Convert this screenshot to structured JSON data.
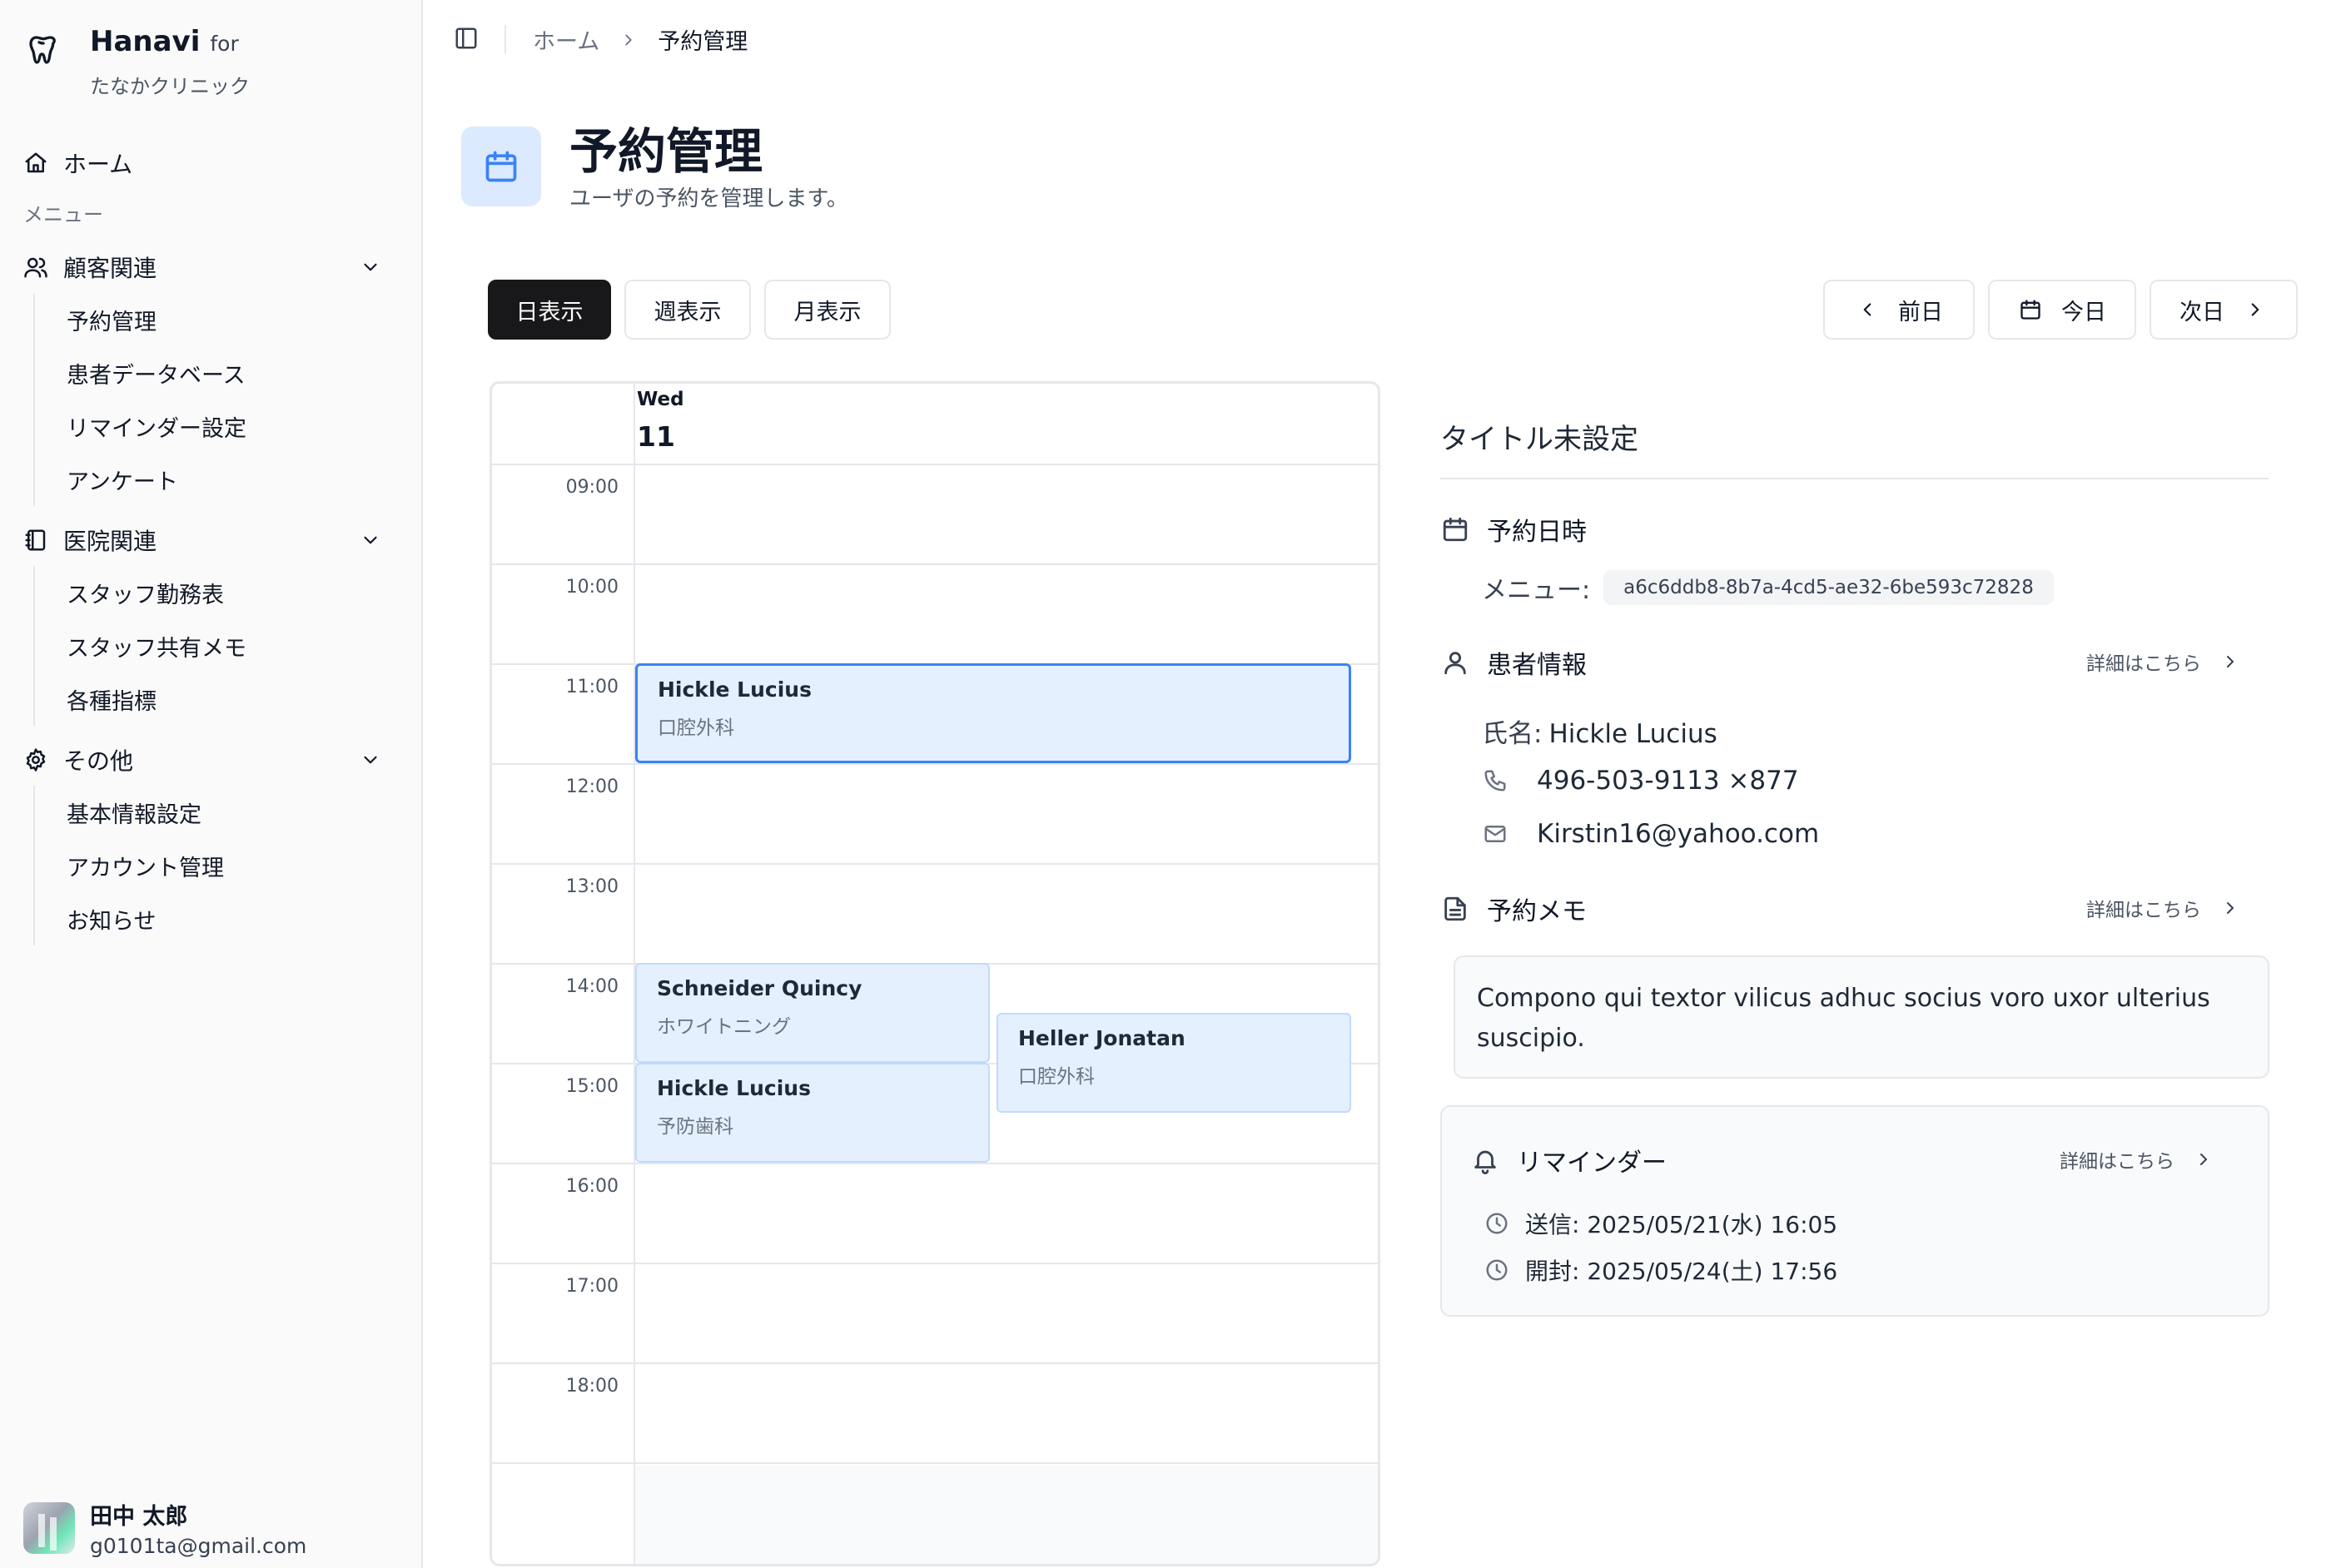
{
  "sidebar": {
    "brand": {
      "name": "Hanavi",
      "for": "for",
      "clinic": "たなかクリニック"
    },
    "home": "ホーム",
    "menu_caption": "メニュー",
    "groups": [
      {
        "label": "顧客関連",
        "icon": "users-icon",
        "items": [
          "予約管理",
          "患者データベース",
          "リマインダー設定",
          "アンケート"
        ]
      },
      {
        "label": "医院関連",
        "icon": "notebook-icon",
        "items": [
          "スタッフ勤務表",
          "スタッフ共有メモ",
          "各種指標"
        ]
      },
      {
        "label": "その他",
        "icon": "gear-icon",
        "items": [
          "基本情報設定",
          "アカウント管理",
          "お知らせ"
        ]
      }
    ],
    "user": {
      "name": "田中 太郎",
      "email": "g0101ta@gmail.com"
    }
  },
  "breadcrumb": {
    "home": "ホーム",
    "current": "予約管理"
  },
  "page": {
    "title": "予約管理",
    "subtitle": "ユーザの予約を管理します。"
  },
  "toolbar": {
    "views": [
      "日表示",
      "週表示",
      "月表示"
    ],
    "active_view": "日表示",
    "prev": "前日",
    "today": "今日",
    "next": "次日"
  },
  "calendar": {
    "day_name": "Wed",
    "day_number": "11",
    "hours": [
      "09:00",
      "10:00",
      "11:00",
      "12:00",
      "13:00",
      "14:00",
      "15:00",
      "16:00",
      "17:00",
      "18:00"
    ],
    "events": [
      {
        "name": "Hickle Lucius",
        "category": "口腔外科",
        "start": "11:00",
        "end": "12:00",
        "selected": true
      },
      {
        "name": "Schneider Quincy",
        "category": "ホワイトニング",
        "start": "14:00",
        "end": "15:00",
        "selected": false
      },
      {
        "name": "Hickle Lucius",
        "category": "予防歯科",
        "start": "15:00",
        "end": "16:00",
        "selected": false
      },
      {
        "name": "Heller Jonatan",
        "category": "口腔外科",
        "start": "14:30",
        "end": "15:30",
        "selected": false
      }
    ]
  },
  "detail": {
    "title": "タイトル未設定",
    "datetime_label": "予約日時",
    "menu_label": "メニュー:",
    "menu_id": "a6c6ddb8-8b7a-4cd5-ae32-6be593c72828",
    "patient_label": "患者情報",
    "details_link": "詳細はこちら",
    "name_label": "氏名:",
    "name_value": "Hickle Lucius",
    "phone": "496-503-9113 ×877",
    "email": "Kirstin16@yahoo.com",
    "memo_label": "予約メモ",
    "memo": "Compono qui textor vilicus adhuc socius voro uxor ulterius suscipio.",
    "reminder_label": "リマインダー",
    "sent": "送信: 2025/05/21(水) 16:05",
    "opened": "開封: 2025/05/24(土) 17:56"
  },
  "colors": {
    "accent": "#3b82f6",
    "event_bg": "#e4f0fd",
    "event_border": "#bfdbfe",
    "active_button": "#18181b"
  }
}
